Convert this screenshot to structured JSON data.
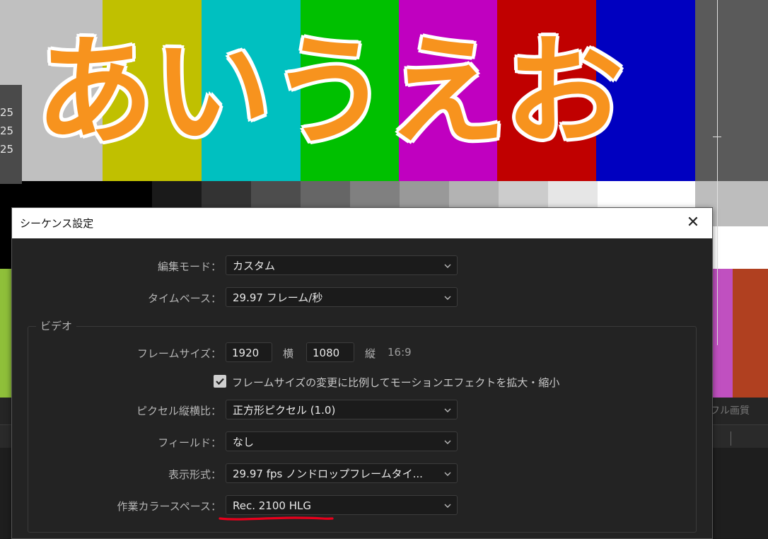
{
  "background": {
    "title_text": "あいうえお",
    "ruler_values": [
      "25",
      "25",
      "25"
    ],
    "bars_top": [
      "#c0c0c0",
      "#c0c000",
      "#00c0c0",
      "#00c000",
      "#c000c0",
      "#c00000",
      "#0000c0"
    ],
    "panel_label": "フル画質"
  },
  "dialog": {
    "title": "シーケンス設定",
    "close_symbol": "✕",
    "rows": {
      "edit_mode": {
        "label": "編集モード：",
        "value": "カスタム"
      },
      "timebase": {
        "label": "タイムベース：",
        "value": "29.97  フレーム/秒"
      }
    },
    "video_section": {
      "title": "ビデオ",
      "frame_size": {
        "label": "フレームサイズ：",
        "width": "1920",
        "width_label": "横",
        "height": "1080",
        "height_label": "縦",
        "aspect": "16:9"
      },
      "scale_checkbox": {
        "label": "フレームサイズの変更に比例してモーションエフェクトを拡大・縮小",
        "checked": true
      },
      "pixel_aspect": {
        "label": "ピクセル縦横比：",
        "value": "正方形ピクセル (1.0)"
      },
      "fields": {
        "label": "フィールド：",
        "value": "なし"
      },
      "display_format": {
        "label": "表示形式：",
        "value": "29.97  fps  ノンドロップフレームタイ..."
      },
      "working_color_space": {
        "label": "作業カラースペース：",
        "value": "Rec. 2100 HLG"
      }
    },
    "annotation_color": "#e8001c"
  }
}
